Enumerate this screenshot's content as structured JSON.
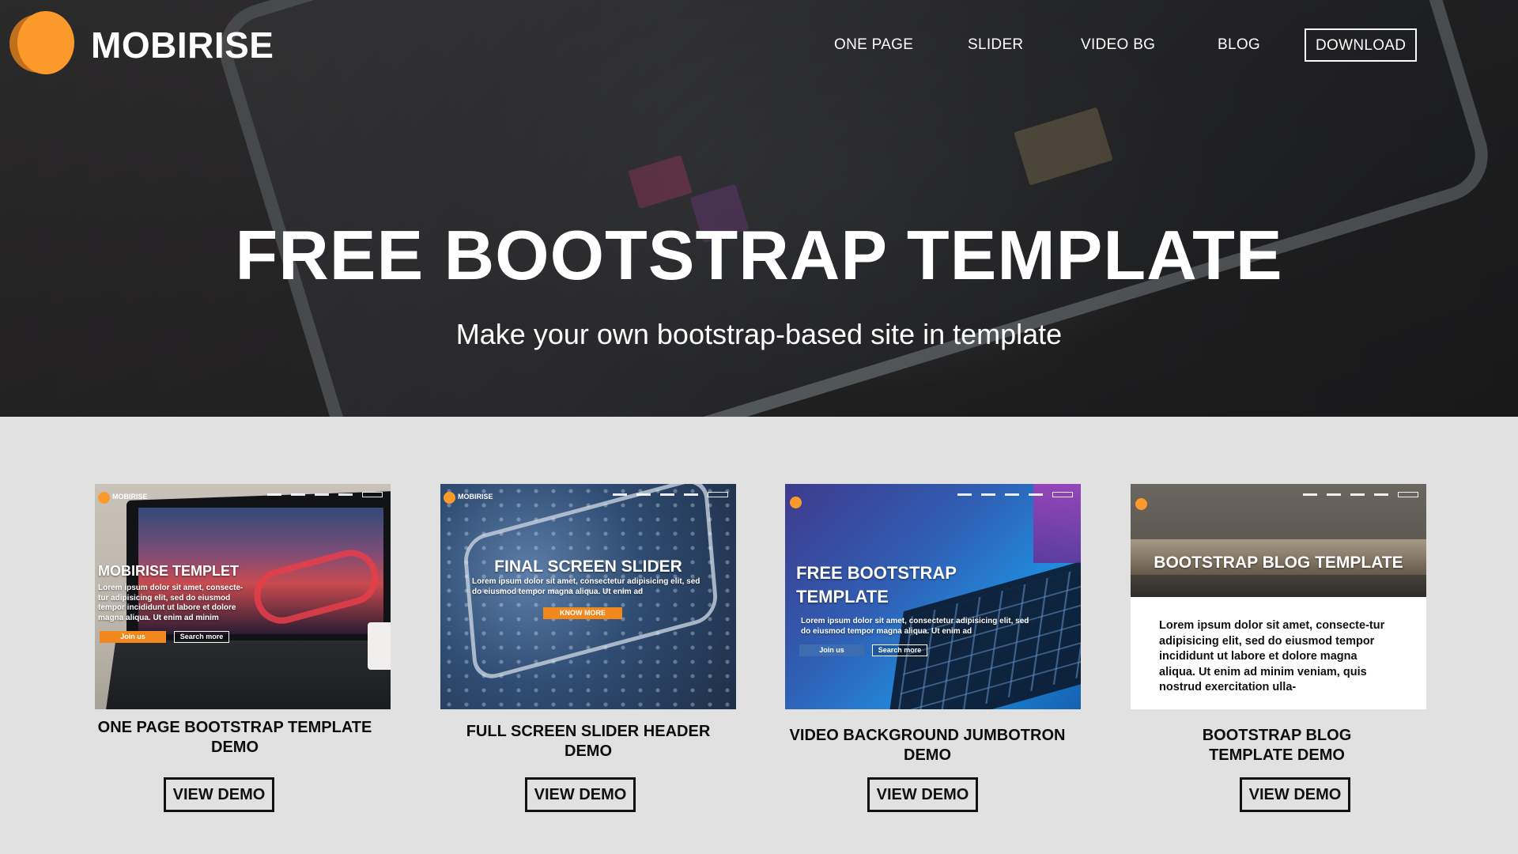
{
  "header": {
    "brand": "MOBIRISE",
    "nav": [
      "ONE PAGE",
      "SLIDER",
      "VIDEO BG",
      "BLOG"
    ],
    "download_label": "DOWNLOAD"
  },
  "hero": {
    "title": "FREE BOOTSTRAP TEMPLATE",
    "subtitle": "Make your own bootstrap-based site in template"
  },
  "cards": [
    {
      "thumb_brand": "MOBIRISE",
      "thumb_title": "MOBIRISE TEMPLET",
      "thumb_text": "Lorem ipsum dolor sit amet, consecte-tur adipisicing elit, sed do eiusmod tempor incididunt ut labore et dolore magna aliqua. Ut enim ad minim",
      "thumb_btn1": "Join us",
      "thumb_btn2": "Search more",
      "title": "ONE PAGE BOOTSTRAP TEMPLATE DEMO",
      "button": "VIEW DEMO"
    },
    {
      "thumb_brand": "MOBIRISE",
      "thumb_title": "FINAL SCREEN SLIDER",
      "thumb_text": "Lorem ipsum dolor sit amet, consectetur adipisicing elit, sed do eiusmod tempor magna aliqua. Ut enim ad",
      "thumb_btn1": "KNOW MORE",
      "title": "FULL SCREEN SLIDER HEADER DEMO",
      "button": "VIEW DEMO"
    },
    {
      "thumb_title": "FREE BOOTSTRAP TEMPLATE",
      "thumb_text": "Lorem ipsum dolor sit amet, consectetur adipisicing elit, sed do eiusmod tempor magna aliqua. Ut enim ad",
      "thumb_btn1": "Join us",
      "thumb_btn2": "Search more",
      "title": "VIDEO BACKGROUND JUMBOTRON DEMO",
      "button": "VIEW DEMO"
    },
    {
      "thumb_title": "BOOTSTRAP BLOG TEMPLATE",
      "thumb_text": "Lorem ipsum dolor sit amet, consecte-tur adipisicing elit, sed do eiusmod tempor incididunt ut labore et dolore magna aliqua. Ut enim ad minim veniam, quis nostrud exercitation ulla-",
      "title": "BOOTSTRAP BLOG TEMPLATE DEMO",
      "button": "VIEW DEMO"
    }
  ],
  "colors": {
    "accent": "#fb9a2a",
    "hero_bg": "#2b2a2c",
    "page_bg": "#e1e1e1"
  }
}
